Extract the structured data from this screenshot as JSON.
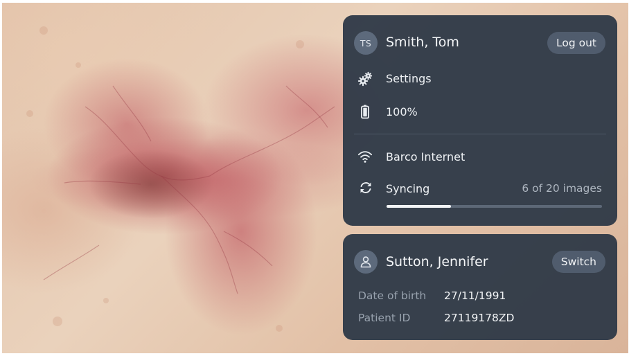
{
  "background": {
    "description_icon": "dermoscopy-image"
  },
  "account": {
    "initials": "TS",
    "user_name": "Smith, Tom",
    "logout_label": "Log out",
    "settings_label": "Settings",
    "settings_icon": "gears-icon",
    "battery_label": "100%",
    "battery_icon": "battery-icon",
    "battery_level": 1.0,
    "network_label": "Barco Internet",
    "network_icon": "wifi-icon",
    "sync_label": "Syncing",
    "sync_icon": "sync-icon",
    "sync_status": "6 of 20 images",
    "sync_progress": 0.3
  },
  "patient": {
    "icon": "person-icon",
    "name": "Sutton, Jennifer",
    "switch_label": "Switch",
    "dob_label": "Date of birth",
    "dob_value": "27/11/1991",
    "id_label": "Patient ID",
    "id_value": "27119178ZD"
  },
  "colors": {
    "panel": "#303a48",
    "pill": "#505c6d",
    "progress_fill": "#f2f4f6",
    "progress_track": "#5d6877",
    "muted_text": "#98a2ae"
  }
}
